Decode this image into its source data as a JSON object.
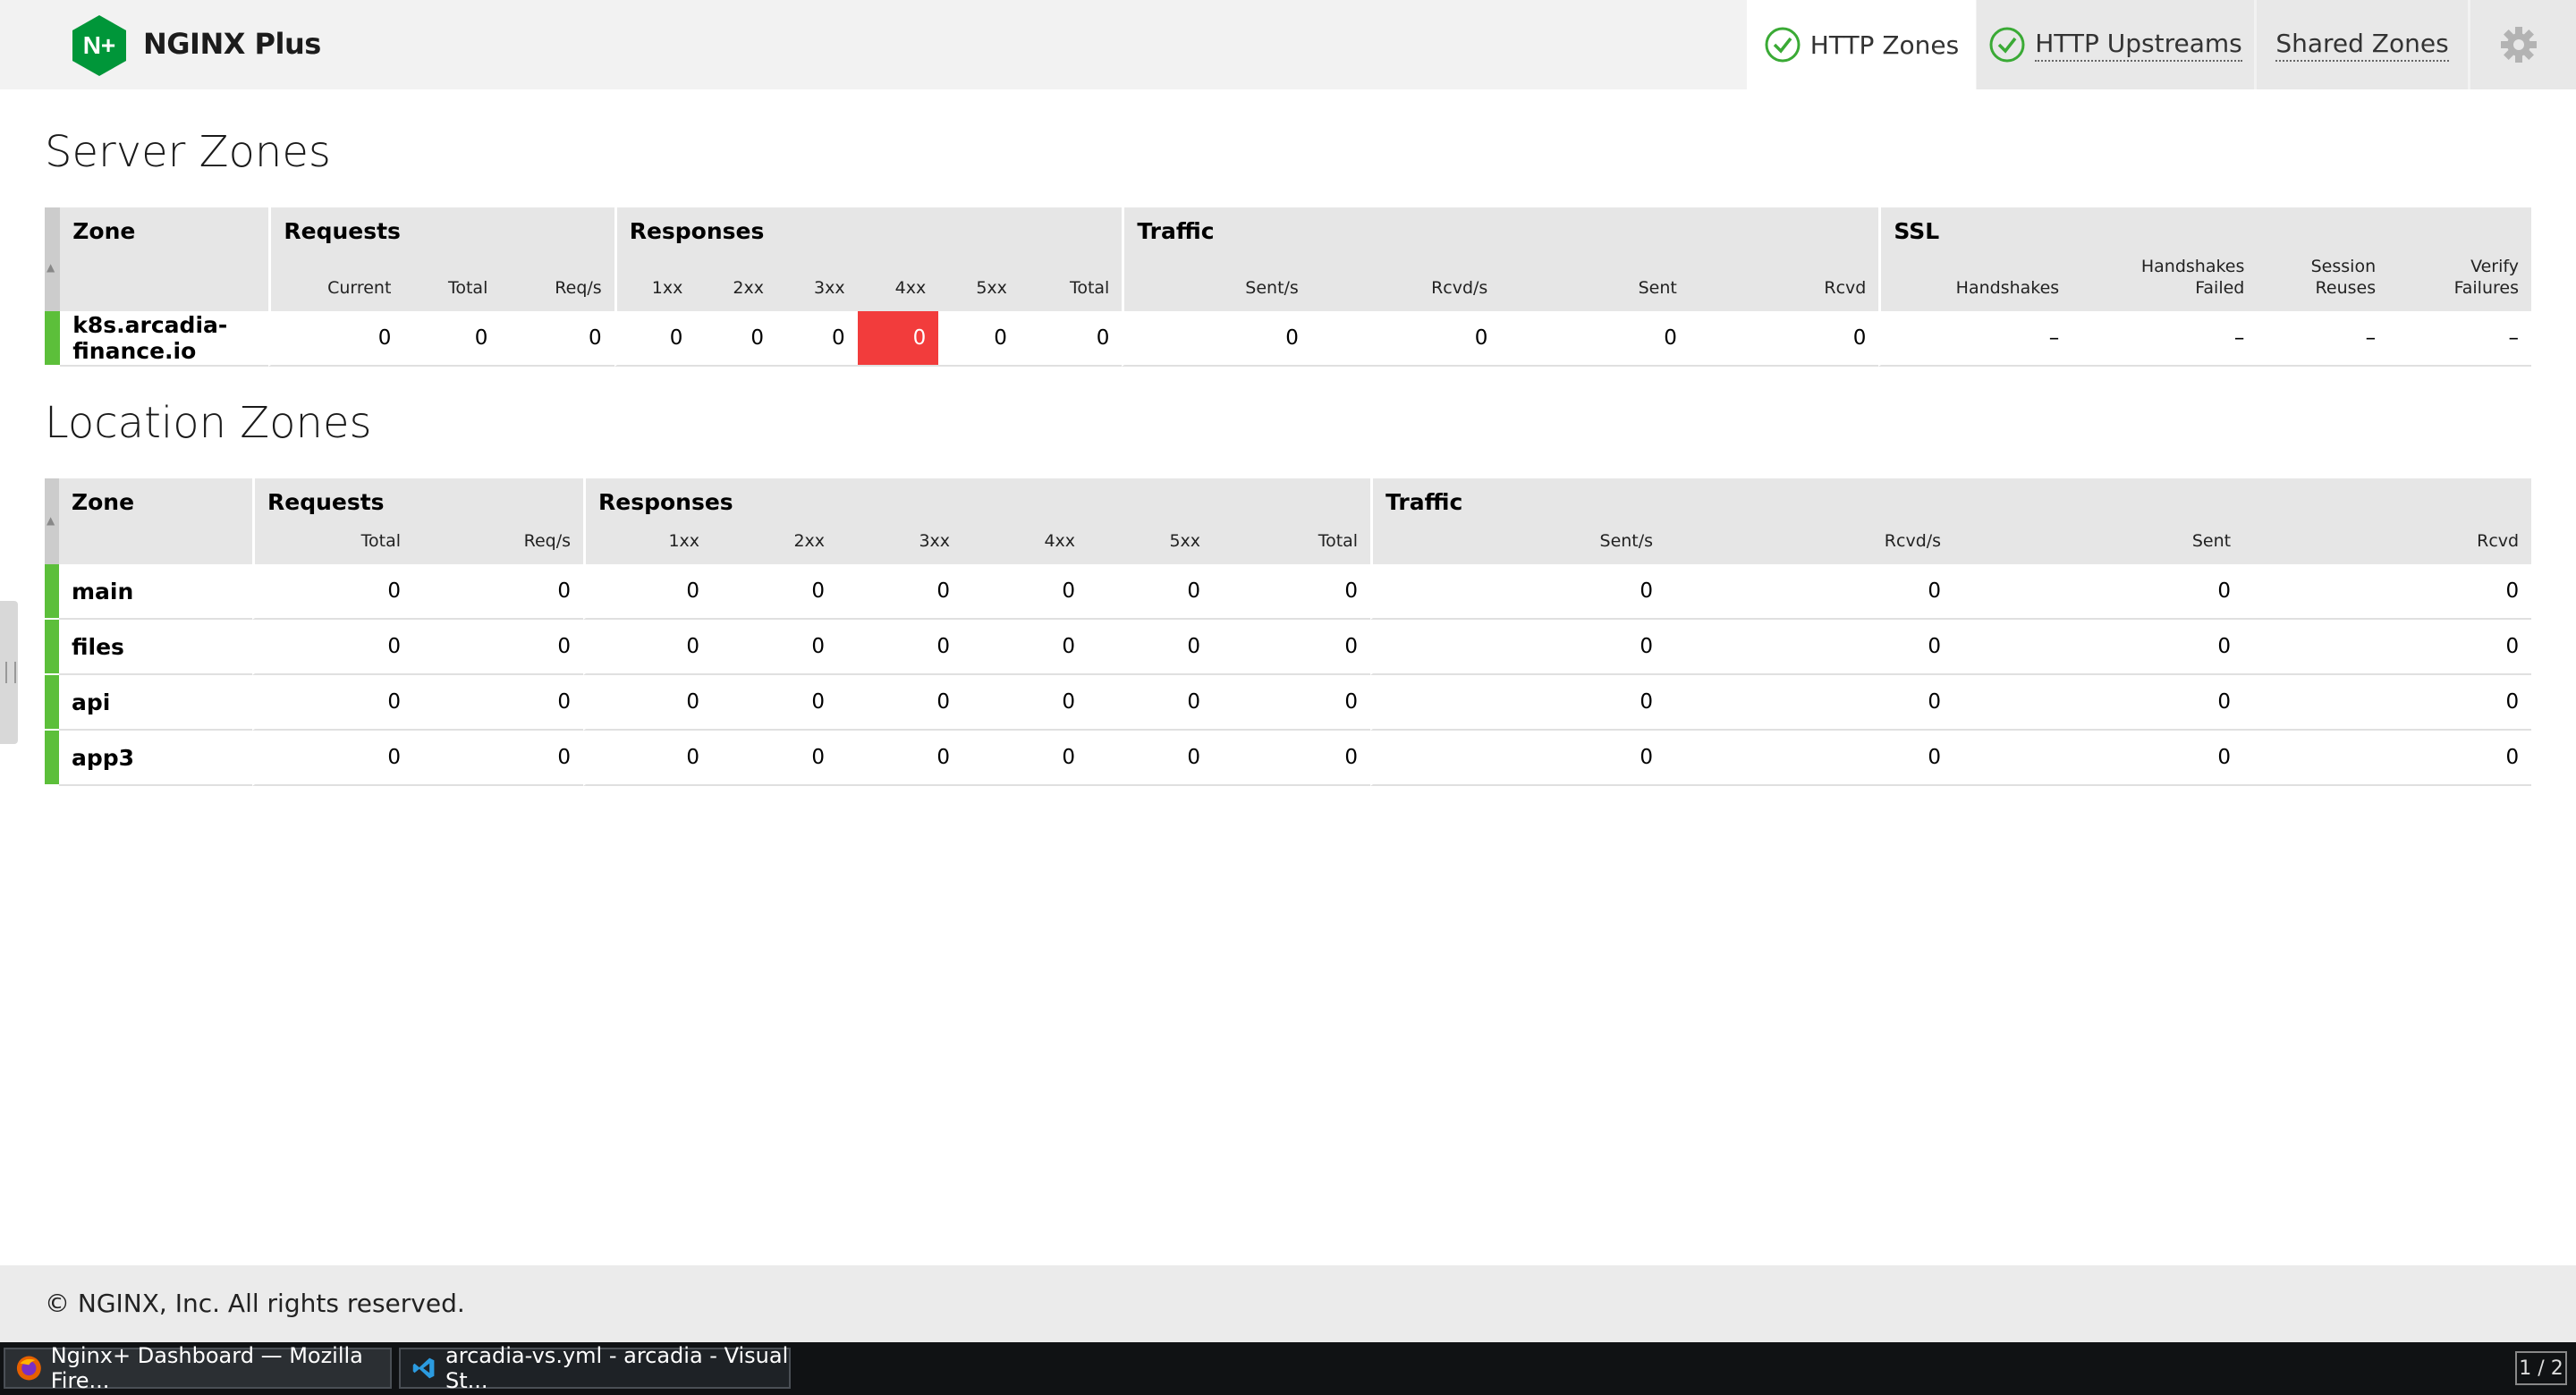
{
  "app": {
    "brand": "NGINX Plus",
    "logo_text": "N+"
  },
  "nav": {
    "tabs": [
      {
        "label": "HTTP Zones",
        "status": "ok",
        "active": true
      },
      {
        "label": "HTTP Upstreams",
        "status": "ok",
        "active": false
      },
      {
        "label": "Shared Zones",
        "active": false
      }
    ],
    "settings_icon": "gear-icon"
  },
  "server_zones": {
    "title": "Server Zones",
    "groups": {
      "zone": "Zone",
      "requests": "Requests",
      "responses": "Responses",
      "traffic": "Traffic",
      "ssl": "SSL"
    },
    "columns": {
      "current": "Current",
      "total": "Total",
      "reqs": "Req/s",
      "r1xx": "1xx",
      "r2xx": "2xx",
      "r3xx": "3xx",
      "r4xx": "4xx",
      "r5xx": "5xx",
      "rtotal": "Total",
      "sent_s": "Sent/s",
      "rcvd_s": "Rcvd/s",
      "sent": "Sent",
      "rcvd": "Rcvd",
      "handshakes": "Handshakes",
      "hs_failed_1": "Handshakes",
      "hs_failed_2": "Failed",
      "session_1": "Session",
      "session_2": "Reuses",
      "verify_1": "Verify",
      "verify_2": "Failures"
    },
    "rows": [
      {
        "name": "k8s.arcadia-finance.io",
        "current": "0",
        "total": "0",
        "reqs": "0",
        "r1xx": "0",
        "r2xx": "0",
        "r3xx": "0",
        "r4xx": "0",
        "r5xx": "0",
        "rtotal": "0",
        "sent_s": "0",
        "rcvd_s": "0",
        "sent": "0",
        "rcvd": "0",
        "handshakes": "–",
        "hs_failed": "–",
        "session": "–",
        "verify": "–"
      }
    ]
  },
  "location_zones": {
    "title": "Location Zones",
    "groups": {
      "zone": "Zone",
      "requests": "Requests",
      "responses": "Responses",
      "traffic": "Traffic"
    },
    "columns": {
      "total": "Total",
      "reqs": "Req/s",
      "r1xx": "1xx",
      "r2xx": "2xx",
      "r3xx": "3xx",
      "r4xx": "4xx",
      "r5xx": "5xx",
      "rtotal": "Total",
      "sent_s": "Sent/s",
      "rcvd_s": "Rcvd/s",
      "sent": "Sent",
      "rcvd": "Rcvd"
    },
    "rows": [
      {
        "name": "main",
        "total": "0",
        "reqs": "0",
        "r1xx": "0",
        "r2xx": "0",
        "r3xx": "0",
        "r4xx": "0",
        "r5xx": "0",
        "rtotal": "0",
        "sent_s": "0",
        "rcvd_s": "0",
        "sent": "0",
        "rcvd": "0"
      },
      {
        "name": "files",
        "total": "0",
        "reqs": "0",
        "r1xx": "0",
        "r2xx": "0",
        "r3xx": "0",
        "r4xx": "0",
        "r5xx": "0",
        "rtotal": "0",
        "sent_s": "0",
        "rcvd_s": "0",
        "sent": "0",
        "rcvd": "0"
      },
      {
        "name": "api",
        "total": "0",
        "reqs": "0",
        "r1xx": "0",
        "r2xx": "0",
        "r3xx": "0",
        "r4xx": "0",
        "r5xx": "0",
        "rtotal": "0",
        "sent_s": "0",
        "rcvd_s": "0",
        "sent": "0",
        "rcvd": "0"
      },
      {
        "name": "app3",
        "total": "0",
        "reqs": "0",
        "r1xx": "0",
        "r2xx": "0",
        "r3xx": "0",
        "r4xx": "0",
        "r5xx": "0",
        "rtotal": "0",
        "sent_s": "0",
        "rcvd_s": "0",
        "sent": "0",
        "rcvd": "0"
      }
    ]
  },
  "footer": {
    "copyright": "© NGINX, Inc. All rights reserved."
  },
  "taskbar": {
    "items": [
      {
        "label": "Nginx+ Dashboard — Mozilla Fire...",
        "icon": "firefox-icon"
      },
      {
        "label": "arcadia-vs.yml - arcadia - Visual St...",
        "icon": "vscode-icon"
      }
    ],
    "pager": "1 / 2"
  },
  "colors": {
    "ok": "#5cbf3a",
    "alert": "#f23c3c",
    "check": "#3aaa35",
    "logo": "#009639"
  }
}
